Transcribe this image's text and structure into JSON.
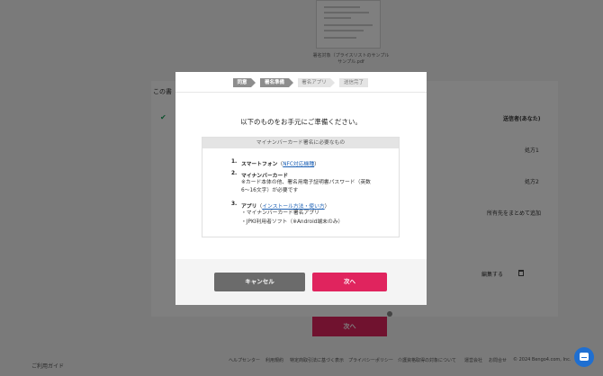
{
  "background": {
    "caption_line1": "署名対象（プライスリストのサンプル",
    "caption_line2": "サンプル.pdf",
    "section_label": "この書",
    "table_header": "送信者(あなた)",
    "row1_value": "処方1",
    "row2_value": "処方2",
    "bulk_action": "所有先をまとめて追加",
    "edit_label": "編集する",
    "next_button": "次へ",
    "footer_links": [
      "ヘルプセンター",
      "利用規約",
      "特定商取引法に基づく表示",
      "プライバシーポリシー",
      "介護資格取得の対象について",
      "運営会社",
      "お問合せ",
      "© 2024 Bengo4.com, Inc."
    ],
    "guide_link": "ご利用ガイド"
  },
  "modal": {
    "steps": [
      "同意",
      "署名準備",
      "署名アプリ",
      "送信完了"
    ],
    "title": "以下のものをお手元にご準備ください。",
    "requirements_header": "マイナンバーカード署名に必要なもの",
    "items": [
      {
        "number": "1.",
        "label": "スマートフォン",
        "link": "NFC対応機種",
        "desc": []
      },
      {
        "number": "2.",
        "label": "マイナンバーカード",
        "link": "",
        "desc": [
          "※カード本体の他、署名用電子証明書パスワード（英数6〜16文字）が必要です"
        ]
      },
      {
        "number": "3.",
        "label": "アプリ",
        "link": "インストール方法・使い方",
        "desc": [
          "・マイナンバーカード署名アプリ",
          "・JPKI利用者ソフト（※Android端末のみ）"
        ]
      }
    ],
    "cancel_button": "キャンセル",
    "next_button": "次へ"
  },
  "icons": {
    "chat": "chat-icon",
    "check": "check-icon",
    "trash": "trash-icon"
  },
  "colors": {
    "accent": "#e0245e",
    "link": "#1a5fb4",
    "step_active": "#8d8d8d",
    "chat": "#1f6fd1"
  }
}
